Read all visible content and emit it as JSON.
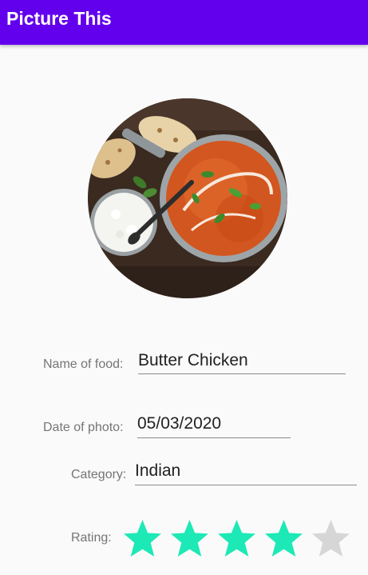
{
  "app_bar": {
    "title": "Picture This",
    "color": "#6200ee"
  },
  "photo": {
    "subject": "butter-chicken-photo"
  },
  "fields": {
    "name": {
      "label": "Name of food:",
      "value": "Butter Chicken"
    },
    "date": {
      "label": "Date of photo:",
      "value": "05/03/2020"
    },
    "category": {
      "label": "Category:",
      "value": "Indian"
    }
  },
  "rating": {
    "label": "Rating:",
    "value": 4,
    "max": 5,
    "filled_color": "#1de9b6",
    "empty_color": "#d6d6d6"
  }
}
